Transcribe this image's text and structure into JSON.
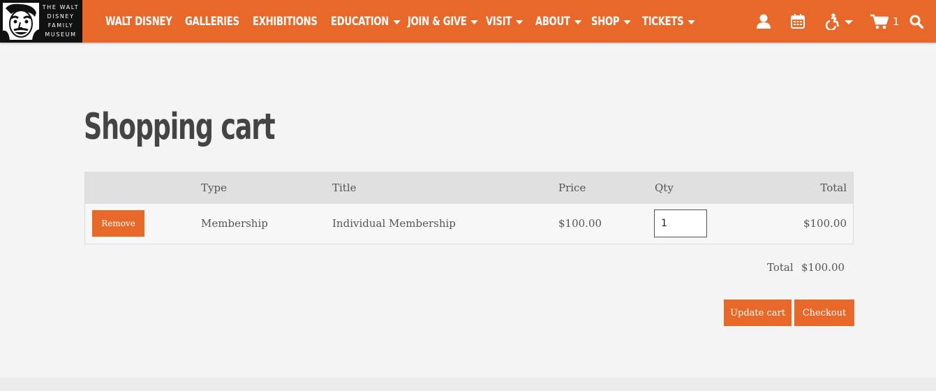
{
  "logo": {
    "lines": [
      "THE WALT",
      "DISNEY",
      "FAMILY",
      "MUSEUM"
    ]
  },
  "nav": {
    "items": [
      {
        "label": "WALT DISNEY",
        "dropdown": false
      },
      {
        "label": "GALLERIES",
        "dropdown": false
      },
      {
        "label": "EXHIBITIONS",
        "dropdown": false
      },
      {
        "label": "EDUCATION",
        "dropdown": true
      },
      {
        "label": "JOIN & GIVE",
        "dropdown": true
      },
      {
        "label": "VISIT",
        "dropdown": true
      },
      {
        "label": "ABOUT",
        "dropdown": true
      },
      {
        "label": "SHOP",
        "dropdown": true
      },
      {
        "label": "TICKETS",
        "dropdown": true
      }
    ],
    "icons": [
      "user-icon",
      "calendar-icon",
      "accessibility-icon",
      "cart-icon",
      "search-icon"
    ],
    "cart_count": "1"
  },
  "page": {
    "title": "Shopping cart"
  },
  "cart": {
    "headers": {
      "type": "Type",
      "title": "Title",
      "price": "Price",
      "qty": "Qty",
      "total": "Total"
    },
    "rows": [
      {
        "remove_label": "Remove",
        "type": "Membership",
        "title": "Individual Membership",
        "price": "$100.00",
        "qty": "1",
        "total": "$100.00"
      }
    ],
    "summary": {
      "total_label": "Total",
      "total_value": "$100.00"
    },
    "actions": {
      "update_label": "Update cart",
      "checkout_label": "Checkout"
    }
  },
  "colors": {
    "accent": "#e8682a",
    "background": "#f4f4f4",
    "header_row": "#e0e0e0",
    "logo_bg": "#111111"
  }
}
